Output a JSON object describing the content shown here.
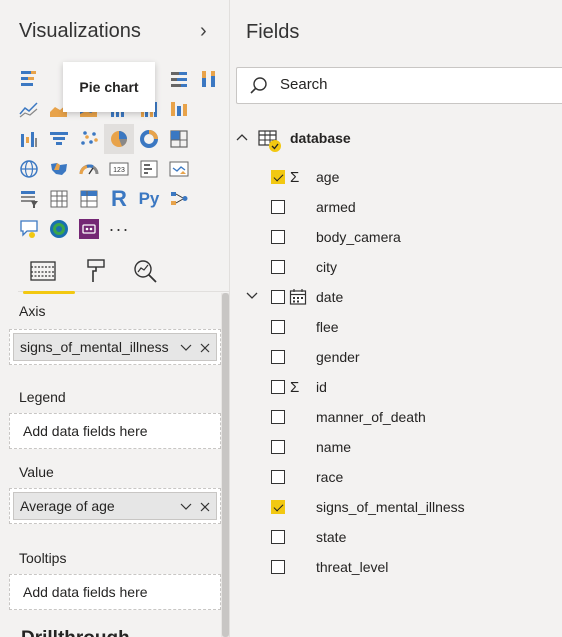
{
  "viz": {
    "title": "Visualizations",
    "tooltip": "Pie chart",
    "visuals": [
      "stacked-bar-icon",
      "clustered-bar-icon",
      "stacked-column-icon",
      "clustered-column-icon",
      "100-bar-icon",
      "100-bar-alt-icon",
      "100-column-icon",
      "line-icon",
      "area-icon",
      "stacked-area-icon",
      "line-column-icon",
      "line-clustered-column-icon",
      "ribbon-icon",
      "waterfall-icon",
      "waterfall-alt-icon",
      "funnel-icon",
      "scatter-icon",
      "pie-icon",
      "donut-icon",
      "treemap-icon",
      "",
      "map-icon",
      "filled-map-icon",
      "gauge-icon",
      "card-icon",
      "multirow-card-icon",
      "kpi-icon",
      "",
      "slicer-icon",
      "table-icon",
      "matrix-icon",
      "r-visual-icon",
      "python-visual-icon",
      "key-influencers-icon",
      "",
      "qa-icon",
      "arcgis-icon",
      "custom-visual-icon",
      "more-icon",
      "",
      "",
      ""
    ],
    "r_label": "R",
    "py_label": "Py",
    "more_label": "···",
    "selected": "pie-icon"
  },
  "wells": {
    "axis_label": "Axis",
    "axis_field": "signs_of_mental_illness",
    "legend_label": "Legend",
    "legend_placeholder": "Add data fields here",
    "value_label": "Value",
    "value_field": "Average of age",
    "tooltips_label": "Tooltips",
    "tooltips_placeholder": "Add data fields here",
    "next_label": "Drillthrough"
  },
  "fields": {
    "title": "Fields",
    "search_placeholder": "Search",
    "table_name": "database",
    "items": [
      {
        "name": "age",
        "checked": true,
        "sigma": true
      },
      {
        "name": "armed",
        "checked": false
      },
      {
        "name": "body_camera",
        "checked": false
      },
      {
        "name": "city",
        "checked": false
      },
      {
        "name": "date",
        "checked": false,
        "date": true
      },
      {
        "name": "flee",
        "checked": false
      },
      {
        "name": "gender",
        "checked": false
      },
      {
        "name": "id",
        "checked": false,
        "sigma": true
      },
      {
        "name": "manner_of_death",
        "checked": false
      },
      {
        "name": "name",
        "checked": false
      },
      {
        "name": "race",
        "checked": false
      },
      {
        "name": "signs_of_mental_illness",
        "checked": true
      },
      {
        "name": "state",
        "checked": false
      },
      {
        "name": "threat_level",
        "checked": false
      }
    ]
  },
  "colors": {
    "accent_yellow": "#f2c811",
    "pane_bg": "#f3f2f1",
    "blue": "#3b78c2",
    "orange": "#e8a34a",
    "purple": "#742774"
  }
}
